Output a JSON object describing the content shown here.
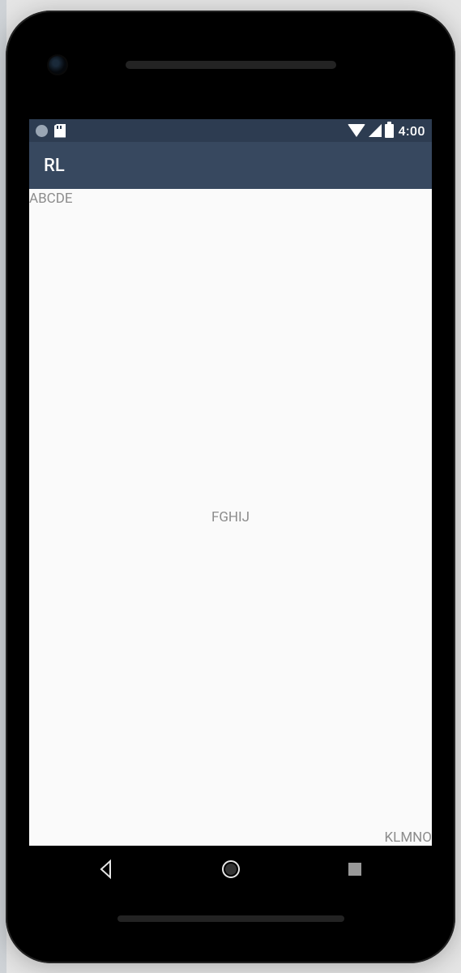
{
  "status_bar": {
    "time": "4:00"
  },
  "app": {
    "title": "RL"
  },
  "content": {
    "top_left": "ABCDE",
    "center": "FGHIJ",
    "bottom_right": "KLMNO"
  }
}
